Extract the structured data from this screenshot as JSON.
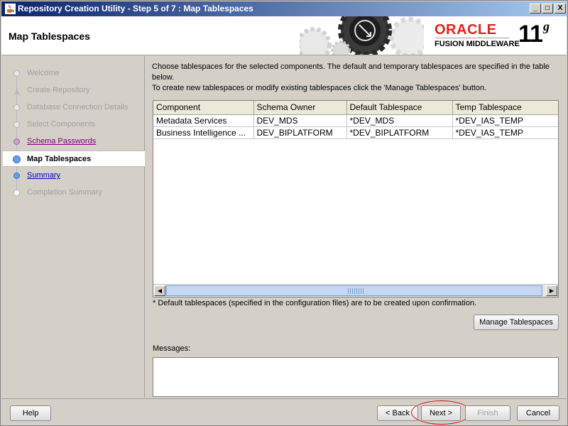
{
  "window": {
    "title": "Repository Creation Utility - Step 5 of 7 : Map Tablespaces",
    "controls": [
      "_",
      "□",
      "X"
    ]
  },
  "header": {
    "page_title": "Map Tablespaces",
    "brand": "ORACLE",
    "product": "FUSION MIDDLEWARE",
    "version": "11",
    "version_suffix": "g"
  },
  "nav": {
    "items": [
      {
        "label": "Welcome",
        "state": "done"
      },
      {
        "label": "Create Repository",
        "state": "done"
      },
      {
        "label": "Database Connection Details",
        "state": "done"
      },
      {
        "label": "Select Components",
        "state": "done"
      },
      {
        "label": "Schema Passwords",
        "state": "visited"
      },
      {
        "label": "Map Tablespaces",
        "state": "current"
      },
      {
        "label": "Summary",
        "state": "next"
      },
      {
        "label": "Completion Summary",
        "state": "disabled"
      }
    ]
  },
  "main": {
    "intro_line1": "Choose tablespaces for the selected components. The default and temporary tablespaces are specified in the table below.",
    "intro_line2": "To create new tablespaces or modify existing tablespaces click the 'Manage Tablespaces' button.",
    "table": {
      "columns": [
        "Component",
        "Schema Owner",
        "Default Tablespace",
        "Temp Tablespace"
      ],
      "rows": [
        [
          "Metadata Services",
          "DEV_MDS",
          "*DEV_MDS",
          "*DEV_IAS_TEMP"
        ],
        [
          "Business Intelligence ...",
          "DEV_BIPLATFORM",
          "*DEV_BIPLATFORM",
          "*DEV_IAS_TEMP"
        ]
      ]
    },
    "footnote": "* Default tablespaces (specified in the configuration files) are to be created upon confirmation.",
    "manage_button": "Manage Tablespaces",
    "messages_label": "Messages:",
    "messages_text": ""
  },
  "footer": {
    "help": "Help",
    "back": "< Back",
    "next": "Next >",
    "finish": "Finish",
    "cancel": "Cancel"
  },
  "colors": {
    "oracle_red": "#e2231a",
    "title_bar_start": "#0a246a",
    "title_bar_end": "#a6caf0",
    "visited_link": "#800080",
    "next_link": "#0000c0",
    "highlight_ring": "#d01010"
  },
  "icons": {
    "app": "java-cup-icon",
    "gears": "gears-graphic-icon"
  }
}
